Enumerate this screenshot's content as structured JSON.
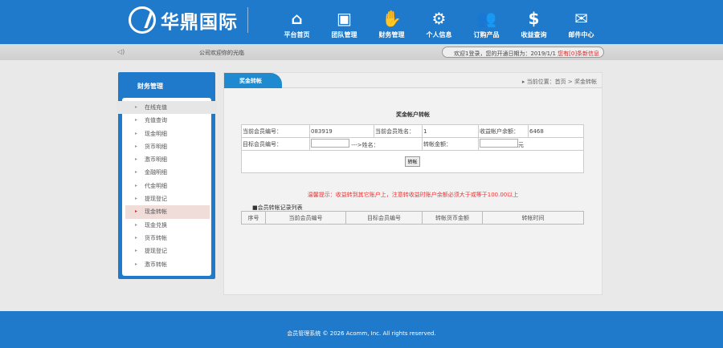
{
  "header": {
    "logo_text": "华鼎国际",
    "nav": [
      {
        "label": "平台首页",
        "icon": "home-icon",
        "glyph": "⌂"
      },
      {
        "label": "团队管理",
        "icon": "team-chat-icon",
        "glyph": "▣"
      },
      {
        "label": "财务管理",
        "icon": "handshake-icon",
        "glyph": "✋"
      },
      {
        "label": "个人信息",
        "icon": "settings-doc-icon",
        "glyph": "⚙"
      },
      {
        "label": "订购产品",
        "icon": "users-icon",
        "glyph": "👥"
      },
      {
        "label": "收益查询",
        "icon": "money-bag-icon",
        "glyph": "$"
      },
      {
        "label": "邮件中心",
        "icon": "mail-icon",
        "glyph": "✉"
      }
    ]
  },
  "bar": {
    "notice": "公司欢迎你的光临",
    "welcome": "欢迎1登录，您的开通日期为：2019/1/1",
    "messages": "您有[0]条新信息"
  },
  "sidebar": {
    "title": "财务管理",
    "items": [
      "在线充值",
      "充值查询",
      "现金明细",
      "货币明细",
      "激币明细",
      "金融明细",
      "代金明细",
      "提现登记",
      "现金转帐",
      "现金兑换",
      "货币转帐",
      "提现登记",
      "激币转帐"
    ],
    "active": 8
  },
  "main": {
    "tab": "奖金转帐",
    "crumb": "当前位置：首页 > 奖金转帐",
    "heading": "奖金帐户转帐",
    "form": {
      "cur_id_label": "当前会员编号：",
      "cur_id": "083919",
      "cur_name_label": "当前会员姓名：",
      "cur_name": "1",
      "balance_label": "收益帐户余额：",
      "balance": "6468",
      "target_label": "目标会员编号：",
      "target_name_label": "--->姓名：",
      "amount_label": "转帐金额：",
      "unit": "元",
      "submit": "转帐"
    },
    "tip": "温馨提示：收益转到其它账户上，注意转收益时账户余额必须大于或等于100.00以上",
    "list_title": "■会员转帐记录列表",
    "columns": [
      "序号",
      "当前会员编号",
      "目标会员编号",
      "转帐货币金额",
      "转帐时间"
    ]
  },
  "footer": "会员管理系统 © 2026 Acomm, Inc. All rights reserved."
}
